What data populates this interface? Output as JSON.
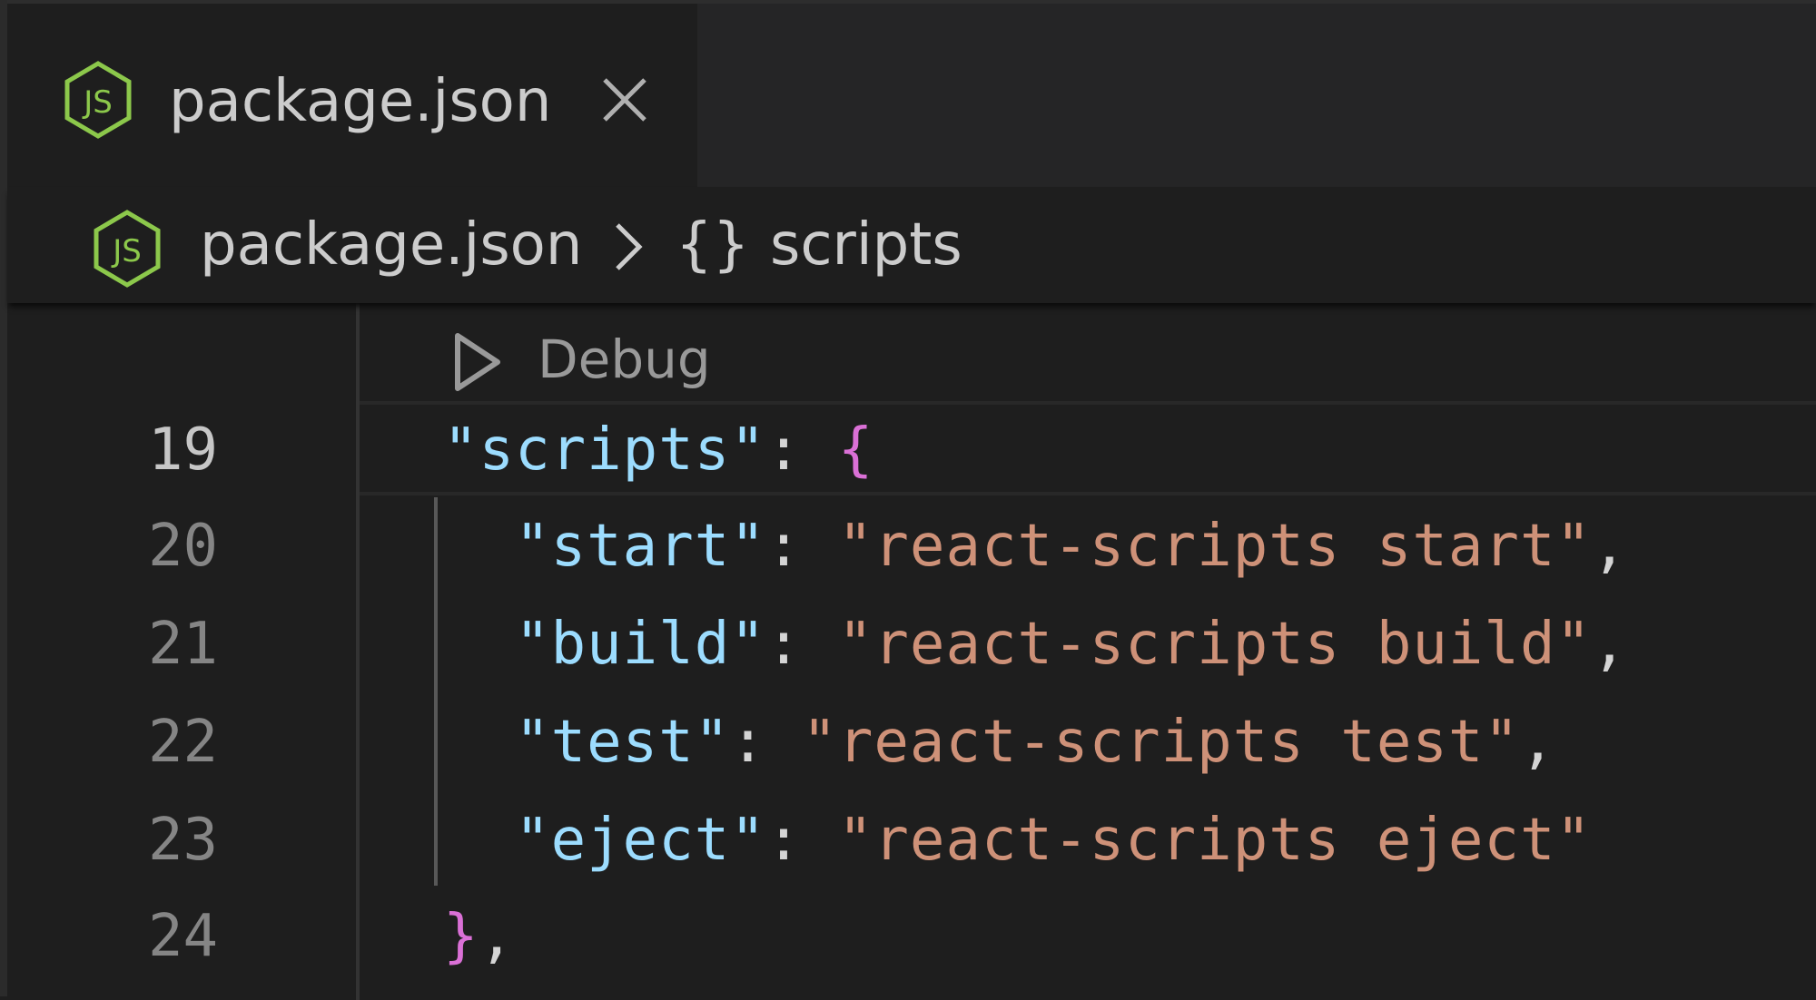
{
  "tab": {
    "title": "package.json",
    "icon": "nodejs-icon"
  },
  "breadcrumb": {
    "file": "package.json",
    "separator": ">",
    "symbol": "{}",
    "item": "scripts"
  },
  "codelens": {
    "label": "Debug"
  },
  "lines": [
    {
      "num": "19",
      "indent": "",
      "key": "\"scripts\"",
      "colon": ": ",
      "value": "",
      "open": "{",
      "tail": ""
    },
    {
      "num": "20",
      "indent": "  ",
      "key": "\"start\"",
      "colon": ": ",
      "value": "\"react-scripts start\"",
      "open": "",
      "tail": ","
    },
    {
      "num": "21",
      "indent": "  ",
      "key": "\"build\"",
      "colon": ": ",
      "value": "\"react-scripts build\"",
      "open": "",
      "tail": ","
    },
    {
      "num": "22",
      "indent": "  ",
      "key": "\"test\"",
      "colon": ": ",
      "value": "\"react-scripts test\"",
      "open": "",
      "tail": ","
    },
    {
      "num": "23",
      "indent": "  ",
      "key": "\"eject\"",
      "colon": ": ",
      "value": "\"react-scripts eject\"",
      "open": "",
      "tail": ""
    },
    {
      "num": "24",
      "indent": "",
      "key": "",
      "colon": "",
      "value": "",
      "open": "}",
      "tail": ","
    }
  ],
  "colors": {
    "background": "#1e1e1e",
    "key": "#9cdcfe",
    "string": "#ce9178",
    "brace": "#da70d6",
    "icon_green": "#8cc84b"
  }
}
